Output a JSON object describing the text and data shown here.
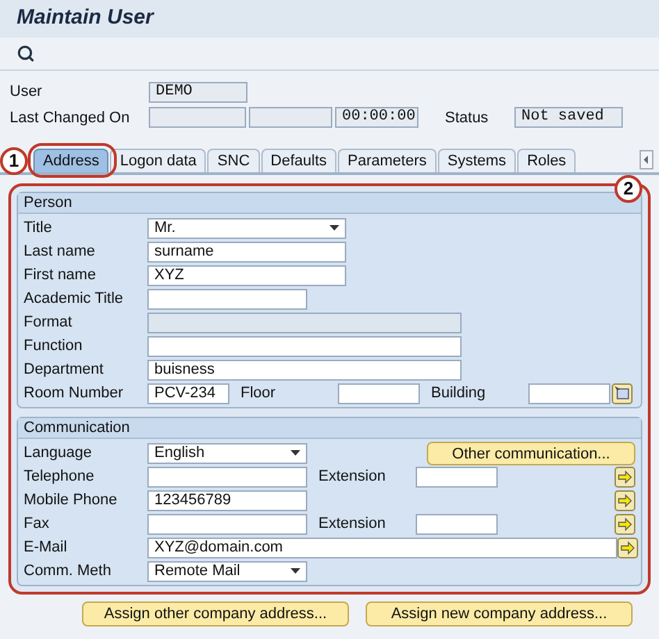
{
  "window": {
    "title": "Maintain User"
  },
  "header": {
    "user_label": "User",
    "user": "DEMO",
    "changed_label": "Last Changed On",
    "time": "00:00:00",
    "status_label": "Status",
    "status": "Not saved"
  },
  "tabs": [
    {
      "label": "Address",
      "selected": true
    },
    {
      "label": "Logon data",
      "selected": false
    },
    {
      "label": "SNC",
      "selected": false
    },
    {
      "label": "Defaults",
      "selected": false
    },
    {
      "label": "Parameters",
      "selected": false
    },
    {
      "label": "Systems",
      "selected": false
    },
    {
      "label": "Roles",
      "selected": false
    }
  ],
  "callouts": {
    "tab": "1",
    "panel": "2"
  },
  "groups": [
    {
      "title": "Person",
      "rows": [
        {
          "label": "Title",
          "items": [
            {
              "kind": "dropdown",
              "value": "Mr."
            }
          ]
        },
        {
          "label": "Last name",
          "items": [
            {
              "kind": "medium",
              "value": "surname"
            }
          ]
        },
        {
          "label": "First name",
          "items": [
            {
              "kind": "medium",
              "value": "XYZ"
            }
          ]
        },
        {
          "label": "Academic Title",
          "items": [
            {
              "kind": "short"
            }
          ]
        },
        {
          "label": "Format",
          "items": [
            {
              "kind": "long",
              "disabled": true
            }
          ]
        },
        {
          "label": "Function",
          "items": [
            {
              "kind": "long"
            }
          ]
        },
        {
          "label": "Department",
          "items": [
            {
              "kind": "long",
              "value": "buisness"
            }
          ]
        },
        {
          "label": "Room Number",
          "items": [
            {
              "kind": "tiny",
              "value": "PCV-234"
            },
            {
              "kind": "label",
              "text": "Floor"
            },
            {
              "kind": "tiny"
            },
            {
              "kind": "label",
              "text": "Building"
            },
            {
              "kind": "tiny"
            },
            {
              "kind": "picker"
            }
          ]
        }
      ]
    },
    {
      "title": "Communication",
      "rows": [
        {
          "label": "Language",
          "items": [
            {
              "kind": "combo",
              "value": "English"
            },
            {
              "kind": "button",
              "text": "Other communication..."
            }
          ]
        },
        {
          "label": "Telephone",
          "items": [
            {
              "kind": "short"
            },
            {
              "kind": "label",
              "text": "Extension"
            },
            {
              "kind": "tiny"
            },
            {
              "kind": "arrow"
            }
          ]
        },
        {
          "label": "Mobile Phone",
          "items": [
            {
              "kind": "short",
              "value": "123456789"
            },
            {
              "kind": "arrow"
            }
          ]
        },
        {
          "label": "Fax",
          "items": [
            {
              "kind": "short"
            },
            {
              "kind": "label",
              "text": "Extension"
            },
            {
              "kind": "tiny"
            },
            {
              "kind": "arrow"
            }
          ]
        },
        {
          "label": "E-Mail",
          "items": [
            {
              "kind": "wide",
              "value": "XYZ@domain.com"
            },
            {
              "kind": "arrow"
            }
          ]
        },
        {
          "label": "Comm. Meth",
          "items": [
            {
              "kind": "combo",
              "value": "Remote Mail"
            }
          ]
        }
      ]
    }
  ],
  "buttons": [
    "Assign other company address...",
    "Assign new company address..."
  ]
}
